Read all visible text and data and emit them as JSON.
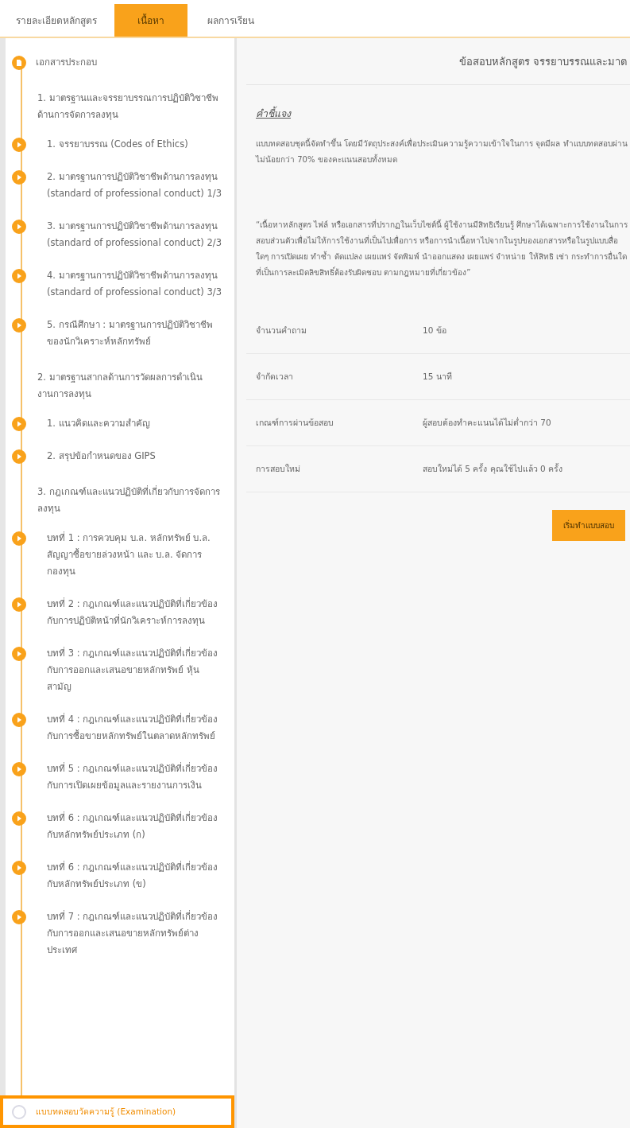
{
  "tabs": [
    {
      "label": "รายละเอียดหลักสูตร",
      "selected": false
    },
    {
      "label": "เนื้อหา",
      "selected": true
    },
    {
      "label": "ผลการเรียน",
      "selected": false
    }
  ],
  "sidebar": {
    "items": [
      {
        "kind": "document",
        "label": "เอกสารประกอบ",
        "completed": true,
        "selected": false
      },
      {
        "kind": "section",
        "label": "1. มาตรฐานและจรรยาบรรณการปฏิบัติวิชาชีพ ด้านการจัดการลงทุน"
      },
      {
        "kind": "lesson",
        "label": "1. จรรยาบรรณ (Codes of Ethics)",
        "completed": true,
        "selected": false
      },
      {
        "kind": "lesson",
        "label": "2. มาตรฐานการปฏิบัติวิชาชีพด้านการลงทุน (standard of professional conduct) 1/3",
        "completed": true,
        "selected": false
      },
      {
        "kind": "lesson",
        "label": "3. มาตรฐานการปฏิบัติวิชาชีพด้านการลงทุน (standard of professional conduct) 2/3",
        "completed": true,
        "selected": false
      },
      {
        "kind": "lesson",
        "label": "4. มาตรฐานการปฏิบัติวิชาชีพด้านการลงทุน (standard of professional conduct) 3/3",
        "completed": true,
        "selected": false
      },
      {
        "kind": "lesson",
        "label": "5. กรณีศึกษา : มาตรฐานการปฏิบัติวิชาชีพของนักวิเคราะห์หลักทรัพย์",
        "completed": true,
        "selected": false
      },
      {
        "kind": "section",
        "label": "2. มาตรฐานสากลด้านการวัดผลการดำเนินงานการลงทุน"
      },
      {
        "kind": "lesson",
        "label": "1. แนวคิดและความสำคัญ",
        "completed": true,
        "selected": false
      },
      {
        "kind": "lesson",
        "label": "2. สรุปข้อกำหนดของ GIPS",
        "completed": true,
        "selected": false
      },
      {
        "kind": "section",
        "label": "3. กฎเกณฑ์และแนวปฏิบัติที่เกี่ยวกับการจัดการลงทุน"
      },
      {
        "kind": "lesson",
        "label": "บทที่ 1 : การควบคุม บ.ล. หลักทรัพย์ บ.ล. สัญญาซื้อขายล่วงหน้า และ บ.ล. จัดการกองทุน",
        "completed": true,
        "selected": false
      },
      {
        "kind": "lesson",
        "label": "บทที่ 2 : กฎเกณฑ์และแนวปฏิบัติที่เกี่ยวข้องกับการปฏิบัติหน้าที่นักวิเคราะห์การลงทุน",
        "completed": true,
        "selected": false
      },
      {
        "kind": "lesson",
        "label": "บทที่ 3 : กฎเกณฑ์และแนวปฏิบัติที่เกี่ยวข้องกับการออกและเสนอขายหลักทรัพย์ หุ้นสามัญ",
        "completed": true,
        "selected": false
      },
      {
        "kind": "lesson",
        "label": "บทที่ 4 : กฎเกณฑ์และแนวปฏิบัติที่เกี่ยวข้องกับการซื้อขายหลักทรัพย์ในตลาดหลักทรัพย์",
        "completed": true,
        "selected": false
      },
      {
        "kind": "lesson",
        "label": "บทที่ 5 : กฎเกณฑ์และแนวปฏิบัติที่เกี่ยวข้องกับการเปิดเผยข้อมูลและรายงานการเงิน",
        "completed": true,
        "selected": false
      },
      {
        "kind": "lesson",
        "label": "บทที่ 6 : กฎเกณฑ์และแนวปฏิบัติที่เกี่ยวข้องกับหลักทรัพย์ประเภท (ก)",
        "completed": true,
        "selected": false
      },
      {
        "kind": "lesson",
        "label": "บทที่ 6 : กฎเกณฑ์และแนวปฏิบัติที่เกี่ยวข้องกับหลักทรัพย์ประเภท (ข)",
        "completed": true,
        "selected": false
      },
      {
        "kind": "lesson",
        "label": "บทที่ 7 : กฎเกณฑ์และแนวปฏิบัติที่เกี่ยวข้องกับการออกและเสนอขายหลักทรัพย์ต่างประเทศ",
        "completed": true,
        "selected": false
      },
      {
        "kind": "exam",
        "label": "แบบทดสอบวัดความรู้ (Examination)",
        "completed": false,
        "selected": true
      }
    ]
  },
  "exam": {
    "title": "ข้อสอบหลักสูตร จรรยาบรรณและมาต",
    "instructions_heading": "คำชี้แจง",
    "instructions": "แบบทดสอบชุดนี้จัดทำขึ้น โดยมีวัตถุประสงค์เพื่อประเมินความรู้ความเข้าใจในการ จุดมีผล ทำแบบทดสอบผ่านไม่น้อยกว่า 70% ของคะแนนสอบทั้งหมด",
    "copyright": "“เนื้อหาหลักสูตร ไฟล์ หรือเอกสารที่ปรากฏในเว็บไซต์นี้ ผู้ใช้งานมีสิทธิเรียนรู้ ศึกษาได้เฉพาะการใช้งานในการสอบส่วนตัวเพื่อไม่ให้การใช้งานที่เป็นไปเพื่อการ หรือการนำเนื้อหาไปจากในรูปของเอกสารหรือในรูปแบบสื่อใดๆ การเปิดเผย ทำซ้ำ ดัดแปลง เผยแพร่ จัดพิมพ์ นำออกแสดง เผยแพร่ จำหน่าย ให้สิทธิ เช่า กระทำการอื่นใดที่เป็นการละเมิดลิขสิทธิ์ต้องรับผิดชอบ ตามกฎหมายที่เกี่ยวข้อง”",
    "details": [
      {
        "label": "จำนวนคำถาม",
        "value": "10 ข้อ"
      },
      {
        "label": "จำกัดเวลา",
        "value": "15 นาที"
      },
      {
        "label": "เกณฑ์การผ่านข้อสอบ",
        "value": "ผู้สอบต้องทำคะแนนได้ไม่ต่ำกว่า 70"
      },
      {
        "label": "การสอบใหม่",
        "value": "สอบใหม่ได้ 5 ครั้ง คุณใช้ไปแล้ว 0 ครั้ง"
      }
    ],
    "start_button": "เริ่มทำแบบสอบ"
  }
}
